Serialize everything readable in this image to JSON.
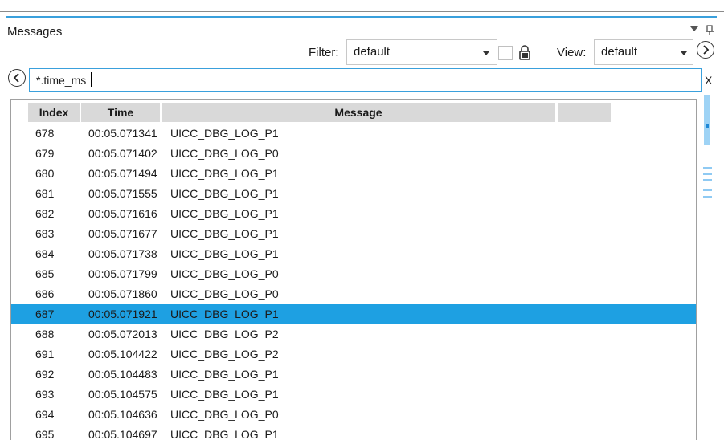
{
  "panel": {
    "title": "Messages"
  },
  "toolbar": {
    "filter_label": "Filter:",
    "filter_value": "default",
    "view_label": "View:",
    "view_value": "default"
  },
  "search": {
    "value": "*.time_ms",
    "clear_label": "X"
  },
  "table": {
    "columns": [
      "Index",
      "Time",
      "Message",
      ""
    ],
    "rows": [
      {
        "index": "678",
        "time": "00:05.071341",
        "message": "UICC_DBG_LOG_P1"
      },
      {
        "index": "679",
        "time": "00:05.071402",
        "message": "UICC_DBG_LOG_P0"
      },
      {
        "index": "680",
        "time": "00:05.071494",
        "message": "UICC_DBG_LOG_P1"
      },
      {
        "index": "681",
        "time": "00:05.071555",
        "message": "UICC_DBG_LOG_P1"
      },
      {
        "index": "682",
        "time": "00:05.071616",
        "message": "UICC_DBG_LOG_P1"
      },
      {
        "index": "683",
        "time": "00:05.071677",
        "message": "UICC_DBG_LOG_P1"
      },
      {
        "index": "684",
        "time": "00:05.071738",
        "message": "UICC_DBG_LOG_P1"
      },
      {
        "index": "685",
        "time": "00:05.071799",
        "message": "UICC_DBG_LOG_P0"
      },
      {
        "index": "686",
        "time": "00:05.071860",
        "message": "UICC_DBG_LOG_P0"
      },
      {
        "index": "687",
        "time": "00:05.071921",
        "message": "UICC_DBG_LOG_P1",
        "selected": true
      },
      {
        "index": "688",
        "time": "00:05.072013",
        "message": "UICC_DBG_LOG_P2"
      },
      {
        "index": "691",
        "time": "00:05.104422",
        "message": "UICC_DBG_LOG_P2"
      },
      {
        "index": "692",
        "time": "00:05.104483",
        "message": "UICC_DBG_LOG_P1"
      },
      {
        "index": "693",
        "time": "00:05.104575",
        "message": "UICC_DBG_LOG_P1"
      },
      {
        "index": "694",
        "time": "00:05.104636",
        "message": "UICC_DBG_LOG_P0"
      },
      {
        "index": "695",
        "time": "00:05.104697",
        "message": "UICC_DBG_LOG_P1"
      }
    ]
  },
  "colors": {
    "accent": "#3aa0dc",
    "selection": "#1ea0e2",
    "header_bg": "#d9d9d9"
  },
  "icons": [
    "dropdown-icon",
    "pin-icon",
    "lock-icon",
    "next-arrow-icon",
    "prev-arrow-icon"
  ]
}
